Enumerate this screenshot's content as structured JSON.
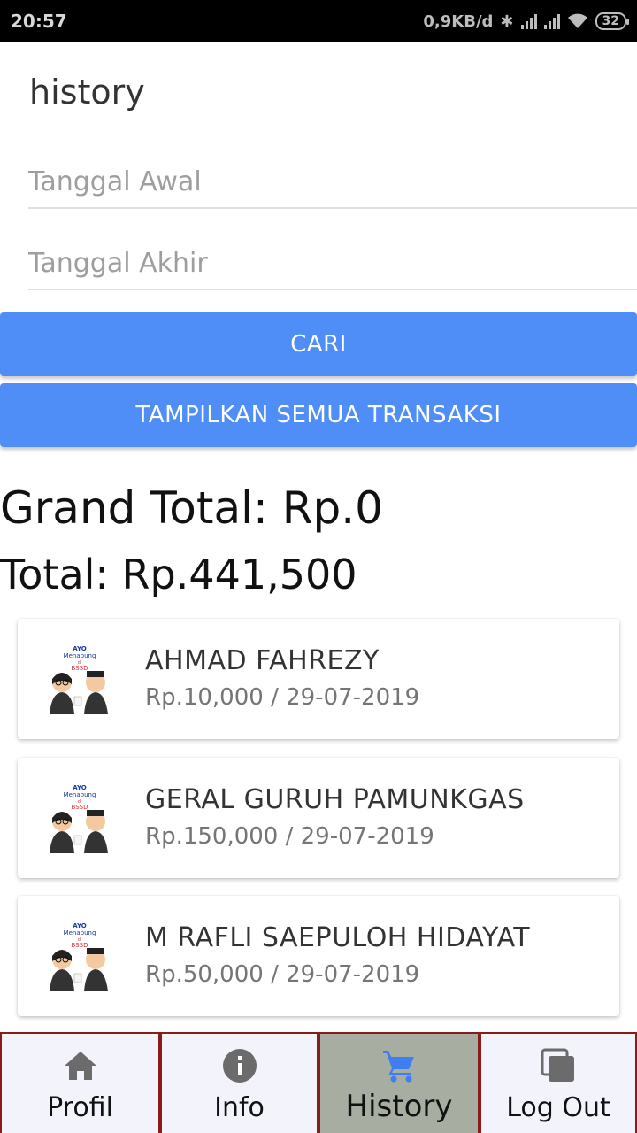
{
  "status_bar": {
    "time": "20:57",
    "net_speed": "0,9KB/d",
    "battery": "32"
  },
  "page": {
    "title": "history"
  },
  "filters": {
    "start_date_placeholder": "Tanggal Awal",
    "end_date_placeholder": "Tanggal Akhir",
    "search_label": "CARI",
    "show_all_label": "TAMPILKAN SEMUA TRANSAKSI"
  },
  "totals": {
    "grand_total": "Grand Total: Rp.0",
    "total": "Total: Rp.441,500"
  },
  "transactions": [
    {
      "name": "AHMAD FAHREZY",
      "detail": "Rp.10,000 / 29-07-2019",
      "logo_text": [
        "AYO",
        "Menabung",
        "di",
        "BSSD"
      ]
    },
    {
      "name": "GERAL GURUH PAMUNKGAS",
      "detail": "Rp.150,000 / 29-07-2019",
      "logo_text": [
        "AYO",
        "Menabung",
        "di",
        "BSSD"
      ]
    },
    {
      "name": "M RAFLI SAEPULOH HIDAYAT",
      "detail": "Rp.50,000 / 29-07-2019",
      "logo_text": [
        "AYO",
        "Menabung",
        "di",
        "BSSD"
      ]
    }
  ],
  "bottom_nav": [
    {
      "label": "Profil",
      "icon": "home-icon",
      "active": false
    },
    {
      "label": "Info",
      "icon": "info-icon",
      "active": false
    },
    {
      "label": "History",
      "icon": "cart-icon",
      "active": true
    },
    {
      "label": "Log Out",
      "icon": "copy-icon",
      "active": false
    }
  ],
  "colors": {
    "accent": "#4f8ef7",
    "active_tab_bg": "#a7ada1",
    "active_icon": "#3f7ef0",
    "nav_border": "#8b1a1a"
  }
}
